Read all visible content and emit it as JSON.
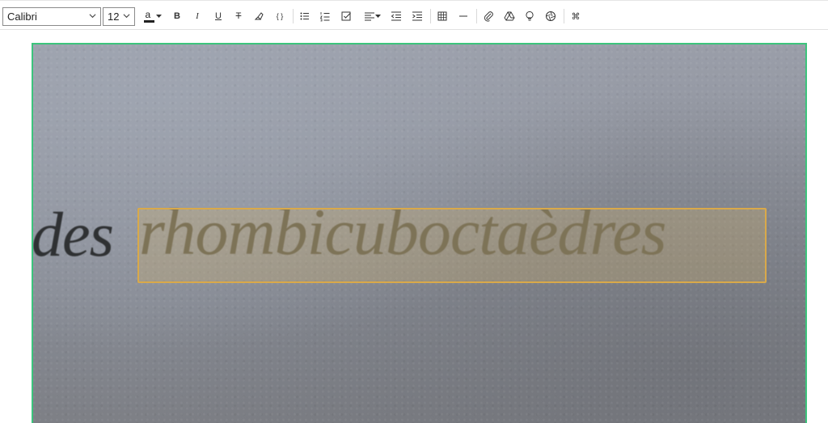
{
  "toolbar": {
    "font_family": "Calibri",
    "font_size": "12",
    "text_color_icon": "a",
    "bold": "B",
    "italic": "I",
    "underline": "U",
    "strikethrough": "T",
    "code": "{ }",
    "shortcut": "⌘"
  },
  "photo": {
    "text_left": "des",
    "text_main": "rhombicuboctaèdres"
  },
  "colors": {
    "frame_border": "#3cc47c",
    "selection_border": "#d9a94a"
  }
}
